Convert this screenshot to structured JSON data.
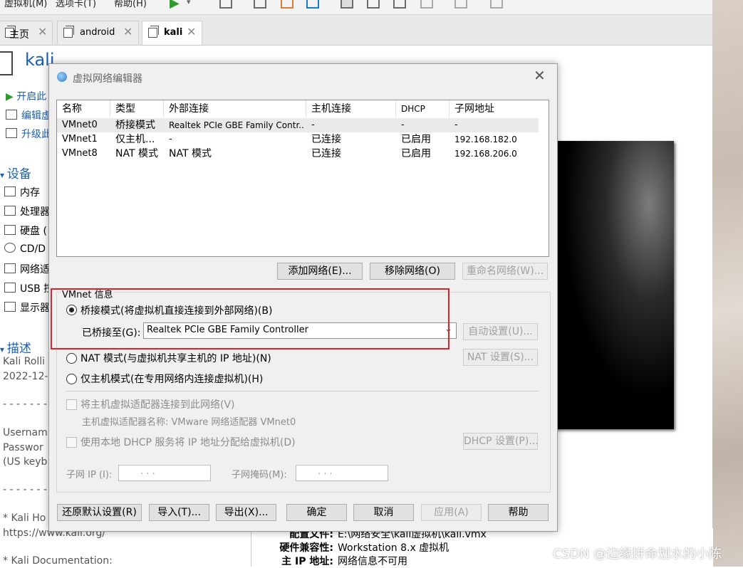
{
  "colors": {
    "accent": "#1a5fb4",
    "highlight_box": "#e0202a",
    "selected_row": "#eaeaea"
  },
  "toolbar": {
    "menu1": "虚拟机(M)",
    "menu2": "选项卡(T)",
    "menu3": "帮助(H)"
  },
  "tabs": [
    {
      "label": "主页",
      "icon": "home-icon"
    },
    {
      "label": "android",
      "icon": "vm-icon"
    },
    {
      "label": "kali",
      "icon": "vm-icon",
      "active": true
    }
  ],
  "vm": {
    "title": "kali",
    "actions": [
      "开启此",
      "编辑虚",
      "升级此"
    ],
    "devices_header": "设备",
    "devices": [
      {
        "label": "内存",
        "icon": "memory-icon"
      },
      {
        "label": "处理器",
        "icon": "cpu-icon"
      },
      {
        "label": "硬盘 (",
        "icon": "disk-icon"
      },
      {
        "label": "CD/D",
        "icon": "cd-icon"
      },
      {
        "label": "网络适",
        "icon": "network-icon"
      },
      {
        "label": "USB 控",
        "icon": "usb-icon"
      },
      {
        "label": "显示器",
        "icon": "display-icon"
      }
    ],
    "description_header": "描述",
    "description_lines": [
      "Kali Rolli",
      "2022-12-",
      "- - - - - - -",
      "Usernam",
      "Passwor",
      "(US keyb",
      "- - - - - - -",
      "* Kali Ho",
      "https://www.kali.org/",
      "* Kali Documentation:"
    ]
  },
  "config": [
    {
      "label": "配置文件:",
      "value": "E:\\网络安全\\kali虚拟机\\kali.vmx"
    },
    {
      "label": "硬件兼容性:",
      "value": "Workstation 8.x 虚拟机"
    },
    {
      "label": "主 IP 地址:",
      "value": "网络信息不可用"
    }
  ],
  "watermark": "CSDN @边缘拼命划水的小陈",
  "dialog": {
    "title": "虚拟网络编辑器",
    "columns": [
      "名称",
      "类型",
      "外部连接",
      "主机连接",
      "DHCP",
      "子网地址"
    ],
    "rows": [
      [
        "VMnet0",
        "桥接模式",
        "Realtek PCIe GBE Family Contr...",
        "-",
        "-",
        "-"
      ],
      [
        "VMnet1",
        "仅主机...",
        "-",
        "已连接",
        "已启用",
        "192.168.182.0"
      ],
      [
        "VMnet8",
        "NAT 模式",
        "NAT 模式",
        "已连接",
        "已启用",
        "192.168.206.0"
      ]
    ],
    "list_buttons": {
      "add": "添加网络(E)...",
      "remove": "移除网络(O)",
      "rename": "重命名网络(W)..."
    },
    "info": {
      "legend": "VMnet 信息",
      "bridged_label": "桥接模式(将虚拟机直接连接到外部网络)(B)",
      "bridged_to_label": "已桥接至(G):",
      "bridged_to_value": "Realtek PCIe GBE Family Controller",
      "auto_btn": "自动设置(U)...",
      "nat_label": "NAT 模式(与虚拟机共享主机的 IP 地址)(N)",
      "nat_btn": "NAT 设置(S)...",
      "hostonly_label": "仅主机模式(在专用网络内连接虚拟机)(H)",
      "connect_adapter_label": "将主机虚拟适配器连接到此网络(V)",
      "adapter_name": "主机虚拟适配器名称: VMware 网络适配器 VMnet0",
      "dhcp_label": "使用本地 DHCP 服务将 IP 地址分配给虚拟机(D)",
      "dhcp_btn": "DHCP 设置(P)...",
      "subnet_ip_label": "子网 IP (I):",
      "subnet_mask_label": "子网掩码(M):",
      "ip_placeholder": ".   .   ."
    },
    "footer": {
      "restore": "还原默认设置(R)",
      "import": "导入(T)...",
      "export": "导出(X)...",
      "ok": "确定",
      "cancel": "取消",
      "apply": "应用(A)",
      "help": "帮助"
    }
  }
}
